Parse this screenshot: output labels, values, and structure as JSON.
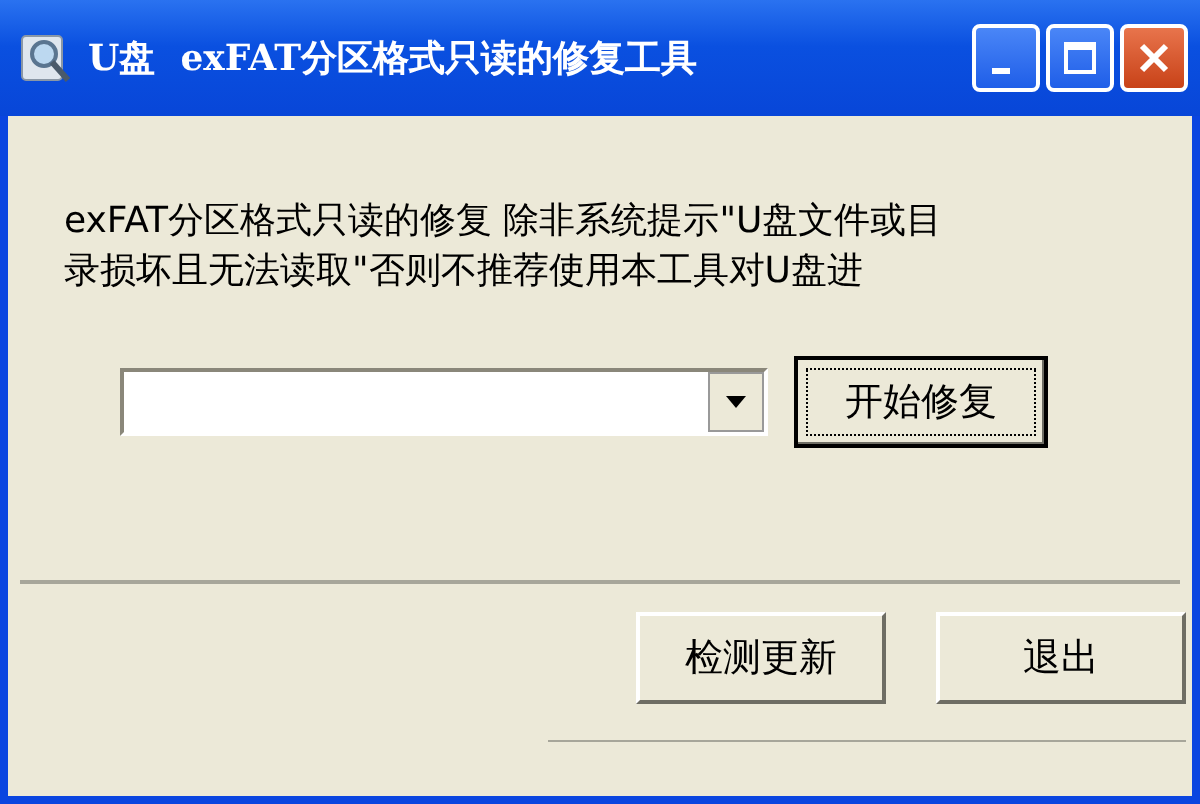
{
  "window": {
    "title": "U盘  exFAT分区格式只读的修复工具"
  },
  "message": "exFAT分区格式只读的修复 除非系统提示\"U盘文件或目录损坏且无法读取\"否则不推荐使用本工具对U盘进",
  "buttons": [
    {
      "label": "开始修复",
      "focused": true
    },
    {
      "label": "检测更新",
      "focused": false
    },
    {
      "label": "退出",
      "focused": false
    }
  ]
}
